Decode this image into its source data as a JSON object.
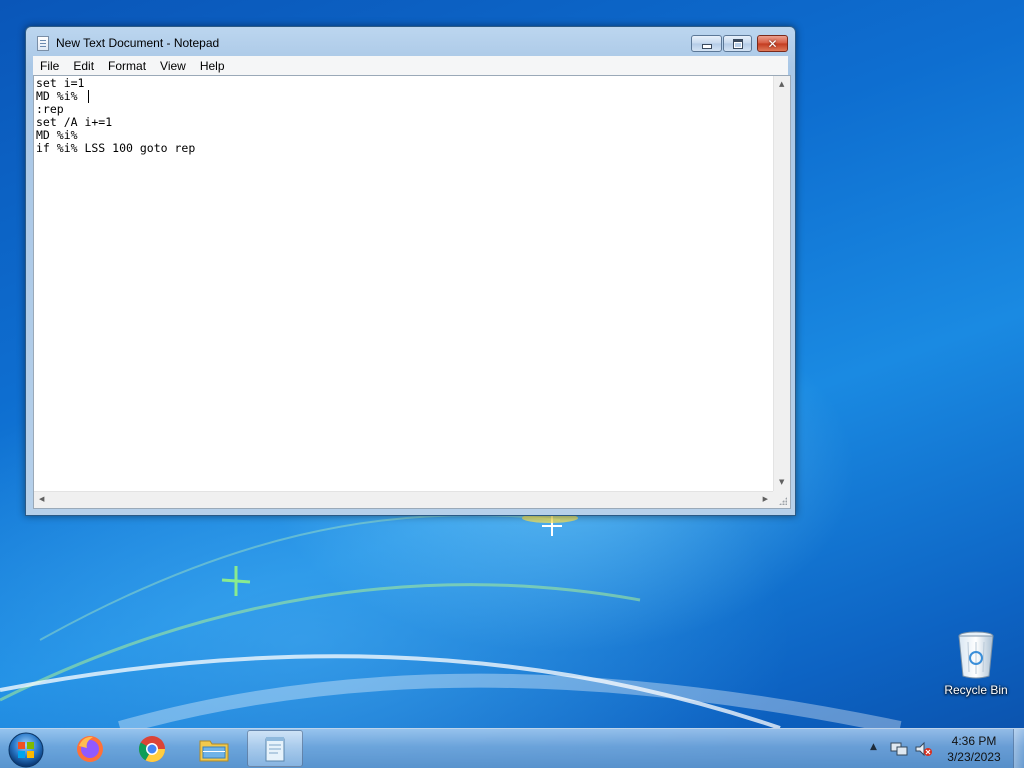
{
  "desktop": {
    "icons": [
      {
        "label": "Recycle Bin",
        "icon": "recycle-bin-icon"
      }
    ]
  },
  "window": {
    "title": "New Text Document - Notepad",
    "icon": "notepad-icon",
    "controls": [
      "minimize-icon",
      "maximize-icon",
      "close-icon"
    ],
    "menu": [
      "File",
      "Edit",
      "Format",
      "View",
      "Help"
    ],
    "editor_text": "set i=1\nMD %i%\n:rep\nset /A i+=1\nMD %i%\nif %i% LSS 100 goto rep"
  },
  "taskbar": {
    "start_icon": "windows-start-icon",
    "pinned": [
      {
        "name": "firefox-icon"
      },
      {
        "name": "chrome-icon"
      },
      {
        "name": "file-explorer-icon"
      },
      {
        "name": "notepad-icon",
        "active": true
      }
    ],
    "tray_icons": [
      "show-hidden-icons-arrow",
      "network-icon",
      "volume-muted-icon"
    ],
    "clock_time": "4:36 PM",
    "clock_date": "3/23/2023"
  },
  "colors": {
    "desktop_blue": "#0e6ed0",
    "window_frame": "#a9c7e6",
    "close_button": "#c23a1f"
  }
}
